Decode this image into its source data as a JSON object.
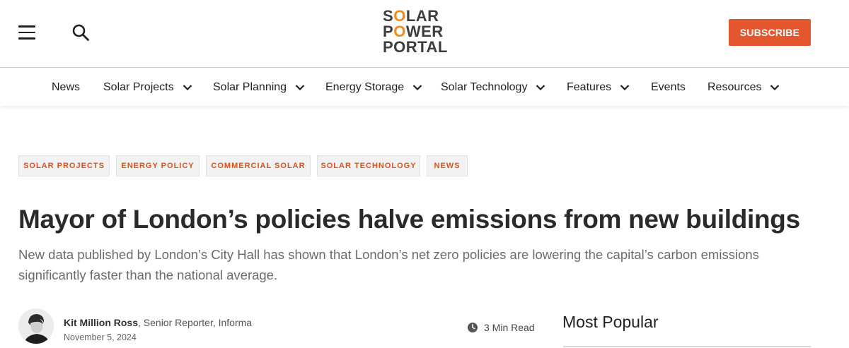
{
  "header": {
    "logo": {
      "line1": [
        "S",
        "O",
        "LAR"
      ],
      "line2": [
        "P",
        "O",
        "WER"
      ],
      "line3": "PORTAL"
    },
    "subscribe_label": "SUBSCRIBE",
    "accent_color": "#e4572e",
    "logo_accent_color": "#f28a1b"
  },
  "nav": {
    "items": [
      {
        "label": "News"
      },
      {
        "label": "Solar Projects"
      },
      {
        "label": "Solar Planning"
      },
      {
        "label": "Energy Storage"
      },
      {
        "label": "Solar Technology"
      },
      {
        "label": "Features"
      },
      {
        "label": "Events"
      },
      {
        "label": "Resources"
      }
    ]
  },
  "tags": [
    "SOLAR PROJECTS",
    "ENERGY POLICY",
    "COMMERCIAL SOLAR",
    "SOLAR TECHNOLOGY",
    "NEWS"
  ],
  "article": {
    "title": "Mayor of London’s policies halve emissions from new buildings",
    "subtitle": "New data published by London’s City Hall has shown that London’s net zero policies are lowering the capital’s carbon emissions significantly faster than the national average.",
    "author_name": "Kit Million Ross",
    "author_role": ", Senior Reporter, Informa",
    "date": "November 5, 2024",
    "read_time": "3 Min Read"
  },
  "sidebar": {
    "most_popular_title": "Most Popular"
  }
}
